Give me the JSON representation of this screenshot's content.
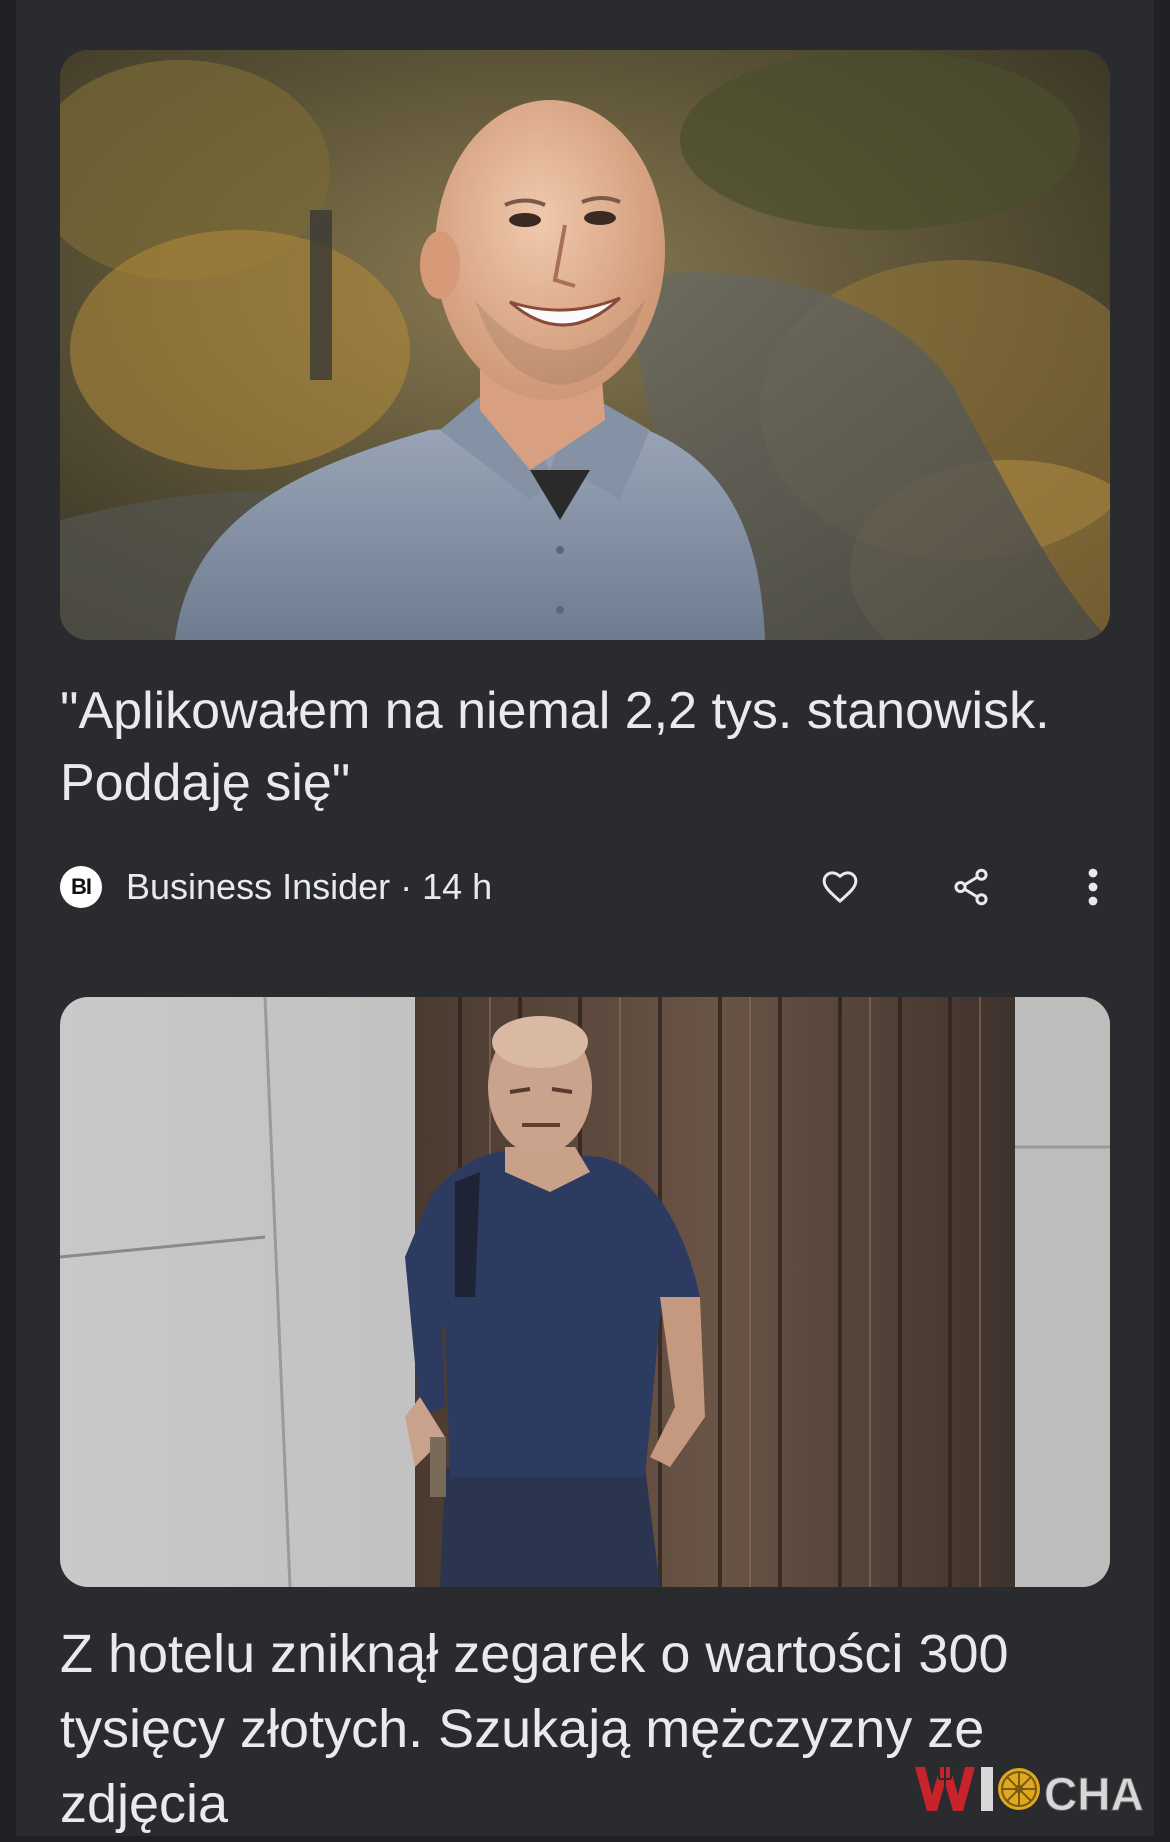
{
  "articles": [
    {
      "headline": "\"Aplikowałem na niemal 2,2 tys. stanowisk. Poddaję się\"",
      "source_logo": "BI",
      "source_text": "Business Insider · 14 h",
      "image_description_icon": "photo-man-smiling-autumn-path",
      "actions": {
        "like_icon": "heart-outline-icon",
        "share_icon": "share-icon",
        "more_icon": "more-vert-icon"
      }
    },
    {
      "headline": "Z hotelu zniknął zegarek o wartości 300 tysięcy złotych. Szukają mężczyzny ze zdjęcia",
      "image_description_icon": "photo-cctv-man-doorway"
    }
  ],
  "watermark": {
    "text": "WIOCHA"
  },
  "colors": {
    "background": "#202124",
    "card": "#2a2b2e",
    "text": "#e8eaed",
    "watermark_red": "#c8232b"
  }
}
